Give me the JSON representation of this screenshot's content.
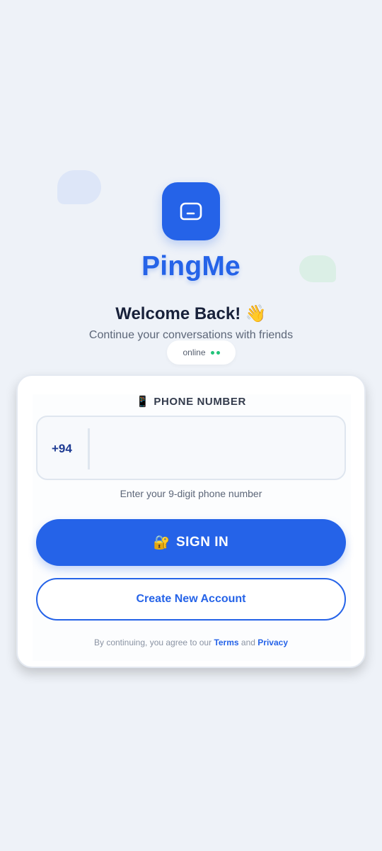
{
  "app": {
    "name": "PingMe",
    "brand_color": "#2563e8"
  },
  "header": {
    "welcome": "Welcome Back! 👋",
    "subtitle": "Continue your conversations with friends",
    "status": "online",
    "status_color": "#22c37a"
  },
  "form": {
    "phone_label": "PHONE NUMBER",
    "phone_label_emoji": "📱",
    "country_code": "+94",
    "phone_value": "",
    "phone_placeholder": "",
    "helper": "Enter your 9-digit phone number",
    "signin_label": "SIGN IN",
    "signin_emoji": "🔐",
    "create_label": "Create New Account"
  },
  "legal": {
    "prefix": "By continuing, you agree to our",
    "terms": "Terms",
    "and": "and",
    "privacy": "Privacy"
  },
  "icons": {
    "app_icon": "chat-bubble-icon"
  }
}
